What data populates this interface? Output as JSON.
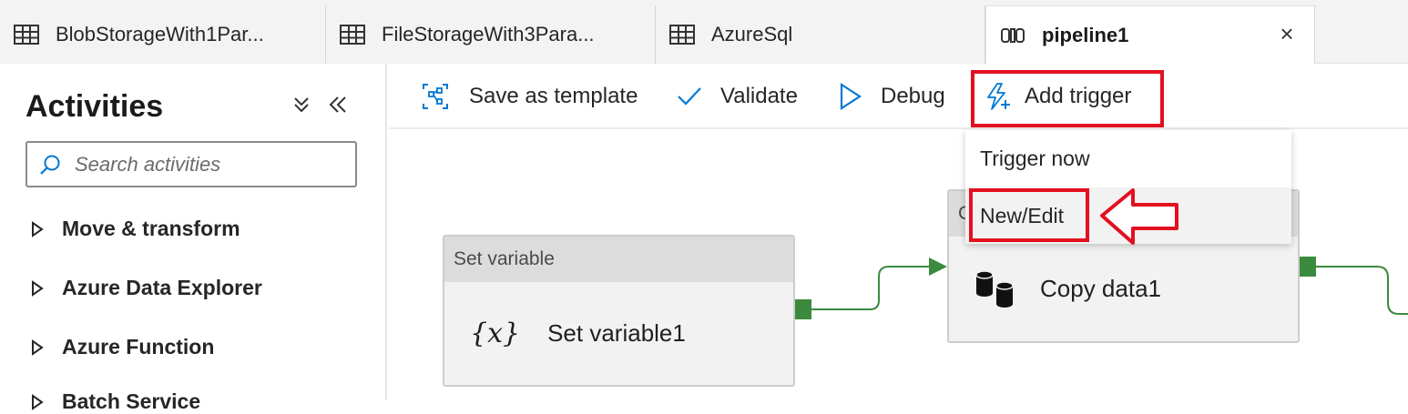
{
  "tabs": [
    {
      "label": "BlobStorageWith1Par...",
      "icon": "table-icon",
      "active": false
    },
    {
      "label": "FileStorageWith3Para...",
      "icon": "table-icon",
      "active": false
    },
    {
      "label": "AzureSql",
      "icon": "table-icon",
      "active": false
    },
    {
      "label": "pipeline1",
      "icon": "pipeline-icon",
      "active": true
    }
  ],
  "close_symbol": "×",
  "sidebar": {
    "title": "Activities",
    "search_placeholder": "Search activities",
    "categories": [
      {
        "label": "Move & transform"
      },
      {
        "label": "Azure Data Explorer"
      },
      {
        "label": "Azure Function"
      },
      {
        "label": "Batch Service"
      }
    ]
  },
  "toolbar": {
    "save_template": "Save as template",
    "validate": "Validate",
    "debug": "Debug",
    "add_trigger": "Add trigger"
  },
  "trigger_menu": {
    "items": [
      {
        "label": "Trigger now"
      },
      {
        "label": "New/Edit"
      }
    ]
  },
  "activities": [
    {
      "type": "Set variable",
      "name": "Set variable1",
      "icon": "variable-icon",
      "icon_text": "{x}"
    },
    {
      "type": "Copy data",
      "name": "Copy data1",
      "icon": "database-icon"
    }
  ],
  "colors": {
    "highlight": "#e3101f",
    "accent": "#0078d4",
    "connector": "#3b8a3e"
  }
}
